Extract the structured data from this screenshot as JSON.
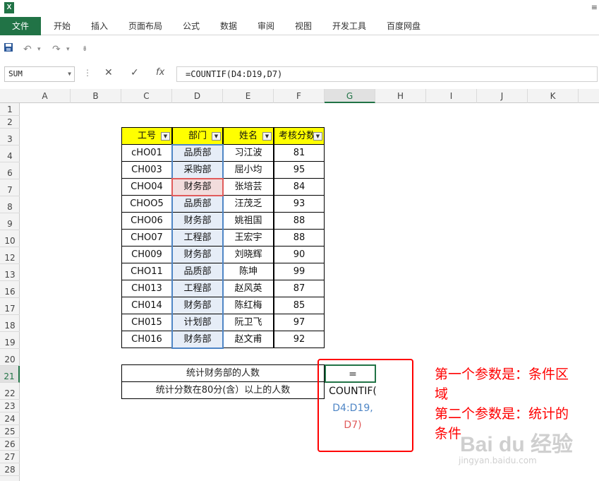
{
  "titlebar": {
    "app_icon": "X",
    "right_text": "≡"
  },
  "ribbon": {
    "tabs": [
      "文件",
      "开始",
      "插入",
      "页面布局",
      "公式",
      "数据",
      "审阅",
      "视图",
      "开发工具",
      "百度网盘"
    ]
  },
  "qat": {
    "save_icon": "floppy-disk-icon",
    "undo": "↶",
    "undo_arrow": "▾",
    "redo": "↷",
    "redo_arrow": "▾",
    "customize": "⇟"
  },
  "formula_bar": {
    "name_box": "SUM",
    "cancel": "✕",
    "enter": "✓",
    "fx": "fx",
    "formula": "=COUNTIF(D4:D19,D7)"
  },
  "columns": [
    "A",
    "B",
    "C",
    "D",
    "E",
    "F",
    "G",
    "H",
    "I",
    "J",
    "K"
  ],
  "rows": [
    "1",
    "2",
    "3",
    "4",
    "6",
    "7",
    "8",
    "9",
    "10",
    "12",
    "13",
    "16",
    "17",
    "18",
    "19",
    "20",
    "21",
    "22",
    "23",
    "24",
    "25",
    "26",
    "27",
    "28"
  ],
  "table": {
    "headers": [
      "工号",
      "部门",
      "姓名",
      "考核分数"
    ],
    "rows": [
      [
        "cHO01",
        "品质部",
        "习江波",
        "81"
      ],
      [
        "CH003",
        "采购部",
        "屈小均",
        "95"
      ],
      [
        "CHO04",
        "财务部",
        "张培芸",
        "84"
      ],
      [
        "CHOO5",
        "品质部",
        "汪茂乏",
        "93"
      ],
      [
        "CHO06",
        "财务部",
        "姚祖国",
        "88"
      ],
      [
        "CHO07",
        "工程部",
        "王宏宇",
        "88"
      ],
      [
        "CH009",
        "财务部",
        "刘晓辉",
        "90"
      ],
      [
        "CHO11",
        "品质部",
        "陈坤",
        "99"
      ],
      [
        "CH013",
        "工程部",
        "赵风英",
        "87"
      ],
      [
        "CH014",
        "财务部",
        "陈红梅",
        "85"
      ],
      [
        "CH015",
        "计划部",
        "阮卫飞",
        "97"
      ],
      [
        "CH016",
        "财务部",
        "赵文甫",
        "92"
      ]
    ]
  },
  "summary": {
    "label1": "统计财务部的人数",
    "label2": "统计分数在80分(含）以上的人数"
  },
  "editing": {
    "line1": "=",
    "line2": "COUNTIF(",
    "line3": "D4:D19,",
    "line4": "D7)"
  },
  "annotation": {
    "line1": "第一个参数是：条件区",
    "line2": "域",
    "line3": "第二个参数是：统计的",
    "line4": "条件"
  },
  "watermark": {
    "main": "Bai du 经验",
    "sub": "jingyan.baidu.com"
  },
  "colors": {
    "excel_green": "#217346",
    "header_yellow": "#ffff00",
    "range_blue": "#4f86c6",
    "range_red": "#e05b5b",
    "annotation_red": "#ff0000"
  }
}
